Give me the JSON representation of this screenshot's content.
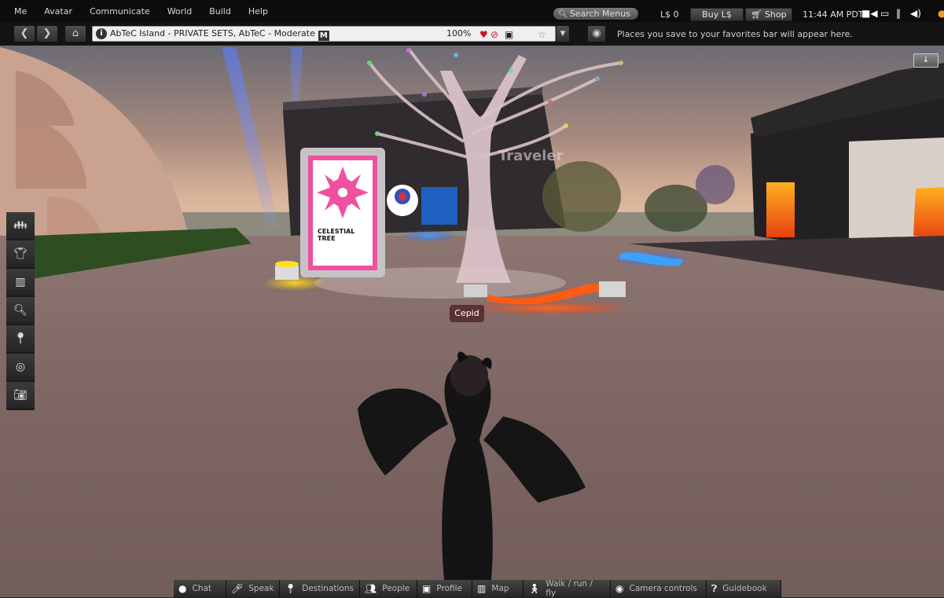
{
  "menubar": {
    "items": [
      "Me",
      "Avatar",
      "Communicate",
      "World",
      "Build",
      "Help"
    ],
    "search_placeholder": "Search Menus",
    "search_icon": "search-icon",
    "balance": "L$ 0",
    "buy_label": "Buy L$",
    "shop_label": "Shop",
    "shop_icon": "cart-icon",
    "clock": "11:44 AM PDT",
    "status_icons": [
      "video-camera-icon",
      "monitor-icon",
      "pause-icon",
      "volume-icon"
    ]
  },
  "navbar": {
    "back_icon": "chevron-left-icon",
    "forward_icon": "chevron-right-icon",
    "home_icon": "home-icon",
    "location": "AbTeC Island - PRIVATE SETS, AbTeC - Moderate",
    "maturity_badge": "M",
    "zoom": "100%",
    "parcel_icons": [
      "heart-icon",
      "no-push-icon",
      "no-build-icon"
    ],
    "favorite_icon": "star-icon",
    "favorites_bar_hint": "Places you save to your favorites bar will appear here."
  },
  "left_toolbar": {
    "buttons": [
      "people-icon",
      "appearance-icon",
      "inventory-icon",
      "search-icon",
      "places-icon",
      "voice-icon",
      "snapshot-icon"
    ]
  },
  "bottom_toolbar": {
    "buttons": [
      {
        "label": "Chat",
        "icon": "chat-icon"
      },
      {
        "label": "Speak",
        "icon": "microphone-icon"
      },
      {
        "label": "Destinations",
        "icon": "location-pin-icon"
      },
      {
        "label": "People",
        "icon": "people-icon"
      },
      {
        "label": "Profile",
        "icon": "profile-icon"
      },
      {
        "label": "Map",
        "icon": "map-icon"
      },
      {
        "label": "Walk / run / fly",
        "icon": "walk-icon"
      },
      {
        "label": "Camera controls",
        "icon": "eye-icon"
      },
      {
        "label": "Guidebook",
        "icon": "help-icon"
      }
    ]
  },
  "scene": {
    "avatar_name": "Cepid",
    "board_title_line1": "CELESTIAL",
    "board_title_line2": "TREE",
    "building_sign": "Traveler",
    "minimize_label": "↓"
  }
}
